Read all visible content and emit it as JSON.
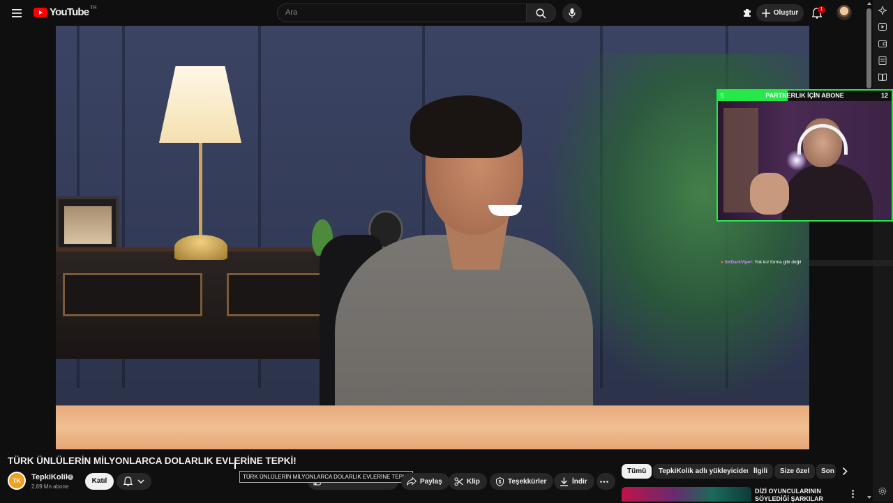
{
  "header": {
    "logo_text": "YouTube",
    "logo_country": "TR",
    "search_placeholder": "Ara",
    "create_label": "Oluştur",
    "notification_count": "1"
  },
  "player": {
    "overlay_bar_text": "PARTNERLIK İÇİN ABONE",
    "overlay_left_number": "5",
    "overlay_right_number": "12",
    "overlay_progress": 0.4,
    "chat_user": "SirDarkViper",
    "chat_message": ": Yok kız forma gibi değil"
  },
  "video": {
    "title": "TÜRK ÜNLÜLERİN MİLYONLARCA DOLARLIK EVLERİNE TEPKİ!",
    "tooltip": "TÜRK ÜNLÜLERİN MİLYONLARCA DOLARLIK EVLERİNE TEPKİ!"
  },
  "channel": {
    "avatar_text": "TK",
    "name": "TepkiKolik",
    "subscribers": "2,69 Mn abone",
    "join_label": "Katıl"
  },
  "actions": {
    "share": "Paylaş",
    "clip": "Klip",
    "thanks": "Teşekkürler",
    "download": "İndir"
  },
  "chips": [
    {
      "label": "Tümü",
      "active": true
    },
    {
      "label": "TepkiKolik adlı yükleyiciden",
      "active": false
    },
    {
      "label": "İlgili",
      "active": false
    },
    {
      "label": "Size özel",
      "active": false
    },
    {
      "label": "Son",
      "active": false
    }
  ],
  "recommended": {
    "title": "DİZİ OYUNCULARININ SÖYLEDİĞİ ŞARKILAR"
  },
  "colors": {
    "brand_red": "#ff0000",
    "overlay_green": "#25e84a",
    "background": "#0f0f0f"
  }
}
